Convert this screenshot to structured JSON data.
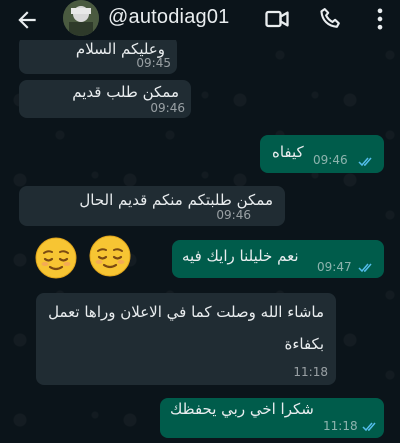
{
  "header": {
    "contact_name": "@autodiag01",
    "icons": [
      "back-arrow-icon",
      "video-call-icon",
      "voice-call-icon",
      "more-options-icon"
    ]
  },
  "colors": {
    "background": "#0b141a",
    "incoming_bubble": "#202c33",
    "outgoing_bubble": "#005c4b",
    "read_ticks": "#53bdeb",
    "text": "#e9edef"
  },
  "messages": [
    {
      "direction": "incoming",
      "text": "وعليكم السلام",
      "time": "09:45"
    },
    {
      "direction": "incoming",
      "text": "ممكن طلب قديم",
      "time": "09:46"
    },
    {
      "direction": "outgoing",
      "text": "كيفاه",
      "time": "09:46",
      "status": "read"
    },
    {
      "direction": "incoming",
      "text": "ممكن طلبتكم منكم قديم الحال",
      "time": "09:46"
    },
    {
      "direction": "incoming",
      "text": "😌😌",
      "emoji_only": true
    },
    {
      "direction": "outgoing",
      "text": "نعم خليلنا رايك فيه",
      "time": "09:47",
      "status": "read"
    },
    {
      "direction": "incoming",
      "text_line1": "ماشاء الله وصلت كما في الاعلان وراها تعمل",
      "text_line2": "بكفاءة",
      "time": "11:18"
    },
    {
      "direction": "outgoing",
      "text": "شكرا اخي ربي يحفظك",
      "time": "11:18",
      "status": "read"
    }
  ]
}
